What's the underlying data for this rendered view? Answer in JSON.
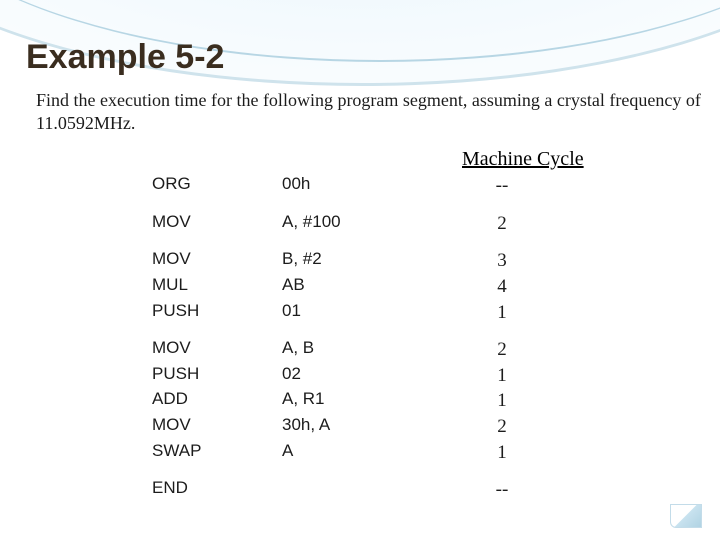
{
  "title": "Example 5-2",
  "prompt": "Find the execution time for the following program segment, assuming a crystal frequency of 11.0592MHz.",
  "column_header": "Machine Cycle",
  "groups": [
    {
      "rows": [
        {
          "mn": "ORG",
          "op": "00h",
          "cyc": "--"
        }
      ]
    },
    {
      "rows": [
        {
          "mn": "MOV",
          "op": "A, #100",
          "cyc": "2"
        }
      ]
    },
    {
      "rows": [
        {
          "mn": "MOV",
          "op": "B, #2",
          "cyc": "3"
        },
        {
          "mn": "MUL",
          "op": "AB",
          "cyc": "4"
        },
        {
          "mn": "PUSH",
          "op": "01",
          "cyc": "1"
        }
      ]
    },
    {
      "rows": [
        {
          "mn": "MOV",
          "op": " A, B",
          "cyc": "2"
        },
        {
          "mn": "PUSH",
          "op": " 02",
          "cyc": "1"
        },
        {
          "mn": "ADD",
          "op": "A, R1",
          "cyc": "1"
        },
        {
          "mn": "MOV",
          "op": " 30h, A",
          "cyc": "2"
        },
        {
          "mn": "SWAP",
          "op": "A",
          "cyc": "1"
        }
      ]
    },
    {
      "rows": [
        {
          "mn": "END",
          "op": "",
          "cyc": "--"
        }
      ]
    }
  ]
}
